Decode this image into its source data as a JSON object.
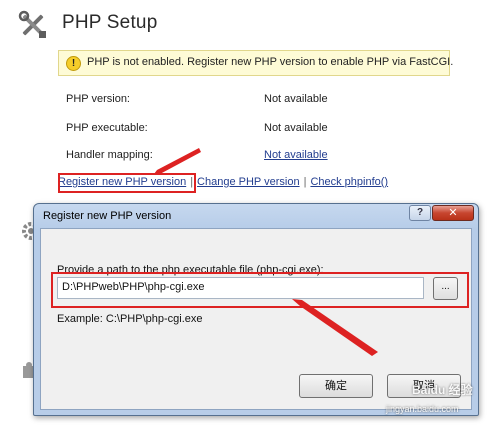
{
  "page": {
    "title": "PHP Setup",
    "warning": {
      "icon": "exclamation-icon",
      "text": "PHP is not enabled. Register new PHP version to enable PHP via FastCGI."
    },
    "info": [
      {
        "label": "PHP version:",
        "value": "Not available"
      },
      {
        "label": "PHP executable:",
        "value": "Not available"
      },
      {
        "label": "Handler mapping:",
        "value": "Not available"
      }
    ],
    "links": {
      "register": "Register new PHP version",
      "change": "Change PHP version",
      "check": "Check phpinfo()",
      "separator": "|"
    }
  },
  "dialog": {
    "title": "Register new PHP version",
    "help_label": "?",
    "close_label": "✕",
    "prompt": "Provide a path to the php executable file (php-cgi.exe):",
    "path_value": "D:\\PHPweb\\PHP\\php-cgi.exe",
    "browse_label": "...",
    "example": "Example: C:\\PHP\\php-cgi.exe",
    "ok_label": "确定",
    "cancel_label": "取消"
  },
  "colors": {
    "highlight": "#dd2222",
    "link": "#223d8f"
  }
}
